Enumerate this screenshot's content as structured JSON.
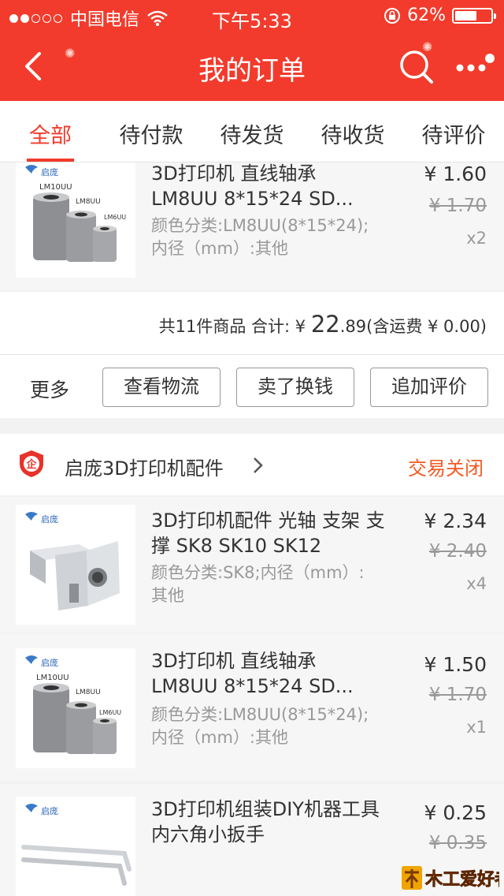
{
  "status_bar": {
    "carrier": "中国电信",
    "time": "下午5:33",
    "battery": "62%",
    "battery_level": 0.62,
    "signal_bars": 2
  },
  "nav": {
    "title": "我的订单"
  },
  "tabs": [
    {
      "label": "全部",
      "active": true
    },
    {
      "label": "待付款",
      "active": false
    },
    {
      "label": "待发货",
      "active": false
    },
    {
      "label": "待收货",
      "active": false
    },
    {
      "label": "待评价",
      "active": false
    }
  ],
  "order1": {
    "item": {
      "thumb_brand": "启庞",
      "thumb_labels": [
        "LM10UU",
        "LM8UU",
        "LM6UU"
      ],
      "title": "3D打印机 直线轴承 LM8UU 8*15*24 SD...",
      "sku": "颜色分类:LM8UU(8*15*24);内径（mm）:其他",
      "price": "¥ 1.60",
      "original_price": "¥ 1.70",
      "qty": "x2"
    },
    "summary": {
      "prefix": "共11件商品 合计: ¥ ",
      "amount_int": "22",
      "amount_dec": ".89",
      "shipping": "(含运费 ¥ 0.00)"
    },
    "actions": {
      "more": "更多",
      "logistics": "查看物流",
      "resell": "卖了换钱",
      "add_review": "追加评价"
    }
  },
  "order2": {
    "shop_badge": "企",
    "shop_name": "启庞3D打印机配件",
    "status": "交易关闭",
    "items": [
      {
        "thumb_brand": "启庞",
        "title": "3D打印机配件 光轴 支架 支撑 SK8 SK10 SK12",
        "sku": "颜色分类:SK8;内径（mm）:其他",
        "price": "¥ 2.34",
        "original_price": "¥ 2.40",
        "qty": "x4"
      },
      {
        "thumb_brand": "启庞",
        "thumb_labels": [
          "LM10UU",
          "LM8UU",
          "LM6UU"
        ],
        "title": "3D打印机 直线轴承 LM8UU 8*15*24 SD...",
        "sku": "颜色分类:LM8UU(8*15*24);内径（mm）:其他",
        "price": "¥ 1.50",
        "original_price": "¥ 1.70",
        "qty": "x1"
      },
      {
        "thumb_brand": "启庞",
        "title": "3D打印机组装DIY机器工具 内六角小扳手",
        "price": "¥ 0.25",
        "original_price": "¥ 0.35"
      }
    ]
  },
  "watermark": "木工爱好者",
  "colors": {
    "brand_red": "#f23b2c",
    "status_orange": "#f25a24"
  }
}
